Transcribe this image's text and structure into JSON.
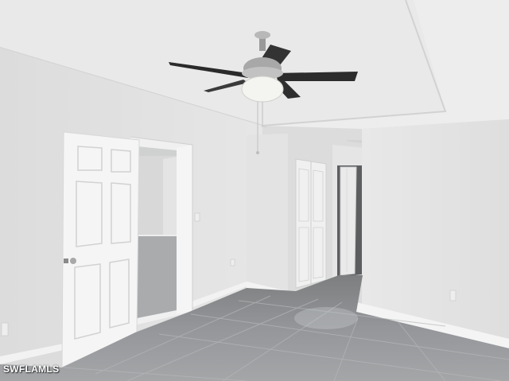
{
  "photo": {
    "watermark": "SWFLAMLS"
  },
  "colors": {
    "wall": "#e4e4e4",
    "ceiling": "#efefef",
    "floor": "#8f9191",
    "door": "#f4f4f4",
    "fan_blade": "#2a2a2a"
  }
}
